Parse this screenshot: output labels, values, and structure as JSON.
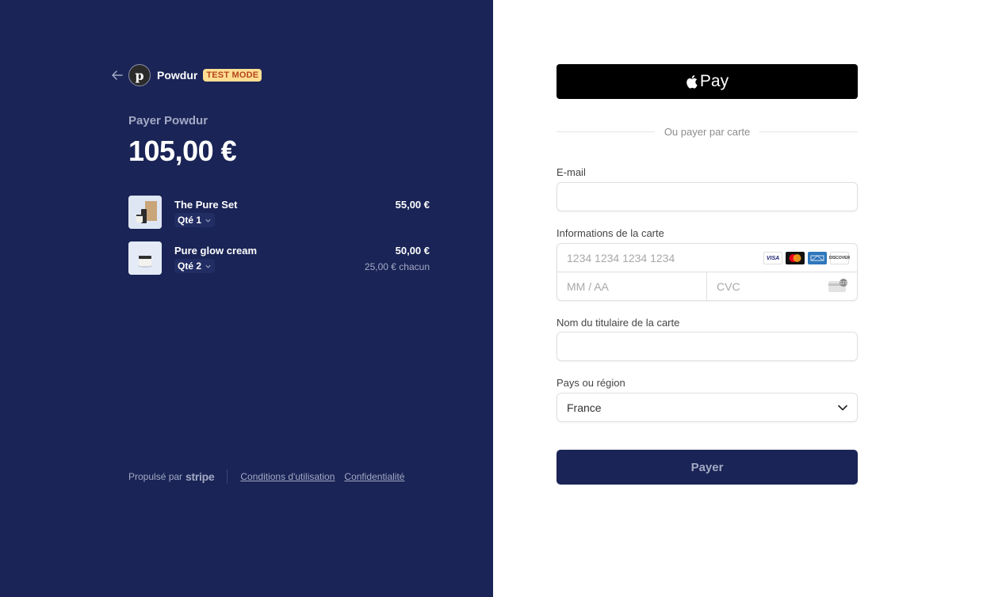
{
  "merchant": {
    "name": "Powdur",
    "logo_letter": "p",
    "badge": "TEST MODE"
  },
  "summary": {
    "pay_label": "Payer Powdur",
    "total": "105,00 €"
  },
  "items": [
    {
      "name": "The Pure Set",
      "qty": "Qté 1",
      "price": "55,00 €",
      "unit_price": ""
    },
    {
      "name": "Pure glow cream",
      "qty": "Qté 2",
      "price": "50,00 €",
      "unit_price": "25,00 € chacun"
    }
  ],
  "footer": {
    "powered_by": "Propulsé par",
    "stripe": "stripe",
    "terms": "Conditions d'utilisation",
    "privacy": "Confidentialité"
  },
  "payment": {
    "apple_pay_label": "Pay",
    "or_text": "Ou payer par carte",
    "email_label": "E-mail",
    "email_value": "",
    "card_label": "Informations de la carte",
    "card_number_placeholder": "1234 1234 1234 1234",
    "expiry_placeholder": "MM / AA",
    "cvc_placeholder": "CVC",
    "card_brands": [
      "VISA",
      "mastercard",
      "AMEX",
      "DISCOVER"
    ],
    "holder_label": "Nom du titulaire de la carte",
    "holder_value": "",
    "country_label": "Pays ou région",
    "country_value": "France",
    "pay_button": "Payer"
  },
  "colors": {
    "left_bg": "#1a2456",
    "badge_bg": "#ffde92",
    "badge_text": "#b3461e",
    "pay_button_bg": "#1a2456"
  }
}
